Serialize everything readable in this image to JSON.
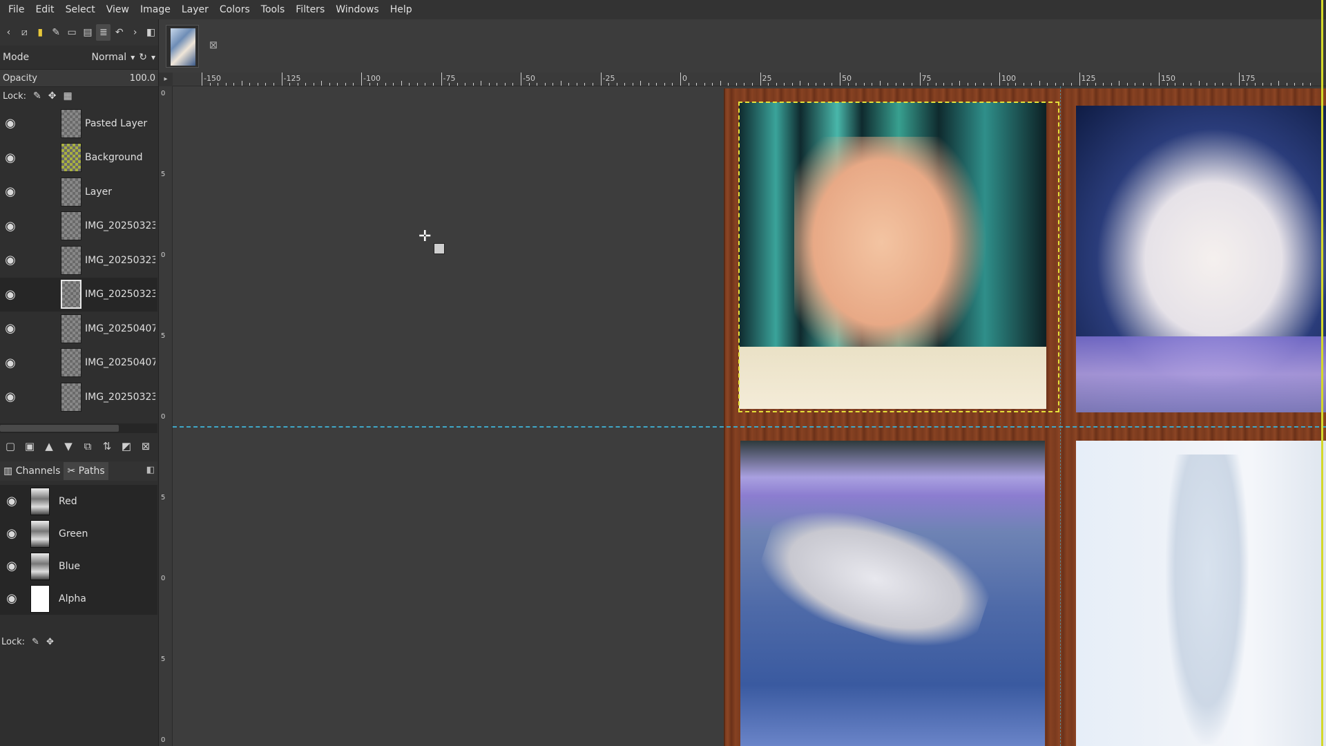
{
  "menu": [
    "File",
    "Edit",
    "Select",
    "View",
    "Image",
    "Layer",
    "Colors",
    "Tools",
    "Filters",
    "Windows",
    "Help"
  ],
  "dock": {
    "mode_label": "Mode",
    "mode_value": "Normal",
    "opacity_label": "Opacity",
    "opacity_value": "100.0",
    "lock_label": "Lock:",
    "layers": [
      {
        "name": "Pasted Layer"
      },
      {
        "name": "Background"
      },
      {
        "name": "Layer"
      },
      {
        "name": "IMG_20250323_"
      },
      {
        "name": "IMG_20250323_"
      },
      {
        "name": "IMG_20250323_"
      },
      {
        "name": "IMG_20250407_"
      },
      {
        "name": "IMG_20250407_"
      },
      {
        "name": "IMG_20250323_"
      }
    ],
    "channel_tabs": {
      "channels": "Channels",
      "paths": "Paths"
    },
    "channels": [
      {
        "name": "Red"
      },
      {
        "name": "Green"
      },
      {
        "name": "Blue"
      },
      {
        "name": "Alpha"
      }
    ],
    "channel_lock_label": "Lock:"
  },
  "ruler": {
    "h_labels": [
      "-150",
      "-125",
      "-100",
      "-75",
      "-50",
      "-25",
      "0",
      "25",
      "50",
      "75",
      "100",
      "125",
      "150",
      "175"
    ],
    "v_labels": [
      "0",
      "5",
      "0",
      "5",
      "0",
      "5",
      "0",
      "5",
      "0"
    ]
  },
  "colors": {
    "selection": "#e6e23a",
    "guide": "#3fa8c8",
    "canvas_edge": "#d4d92a"
  }
}
